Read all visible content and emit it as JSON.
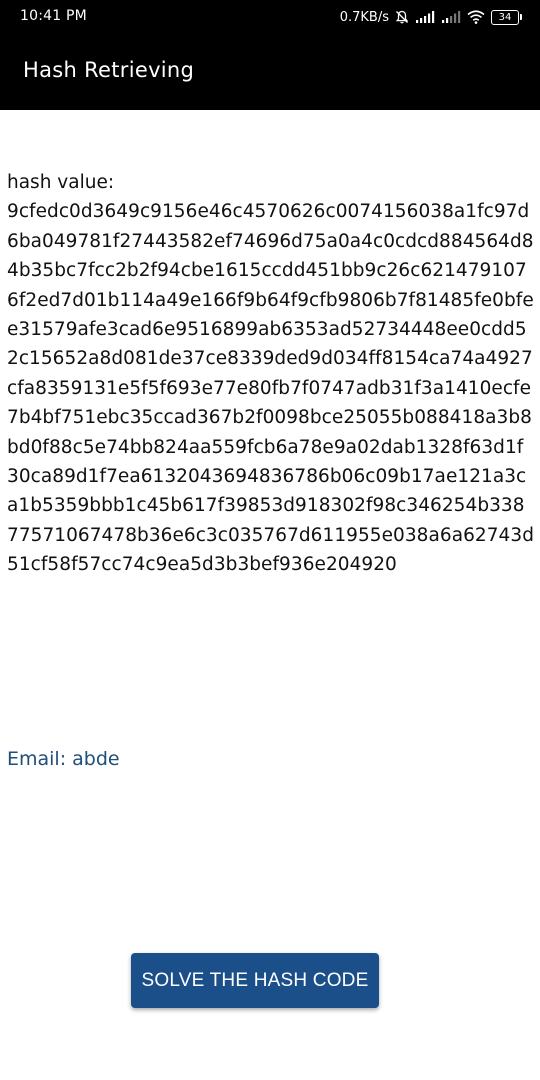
{
  "status_bar": {
    "time": "10:41 PM",
    "network_speed": "0.7KB/s",
    "battery": "34",
    "icons": [
      "alarm-off-icon",
      "signal-icon",
      "signal-weak-icon",
      "wifi-icon",
      "battery-icon"
    ]
  },
  "app_bar": {
    "title": "Hash Retrieving"
  },
  "hash": {
    "label": "hash value:",
    "value": "9cfedc0d3649c9156e46c4570626c0074156038a1fc97d6ba049781f27443582ef74696d75a0a4c0cdcd884564d84b35bc7fcc2b2f94cbe1615ccdd451bb9c26c6214791076f2ed7d01b114a49e166f9b64f9cfb9806b7f81485fe0bfee31579afe3cad6e9516899ab6353ad52734448ee0cdd52c15652a8d081de37ce8339ded9d034ff8154ca74a4927cfa8359131e5f5f693e77e80fb7f0747adb31f3a1410ecfe7b4bf751ebc35ccad367b2f0098bce25055b088418a3b8bd0f88c5e74bb824aa559fcb6a78e9a02dab1328f63d1f30ca89d1f7ea6132043694836786b06c09b17ae121a3ca1b5359bbb1c45b617f39853d918302f98c346254b33877571067478b36e6c3c035767d611955e038a6a62743d51cf58f57cc74c9ea5d3b3bef936e204920"
  },
  "email": {
    "text": "Email: abde"
  },
  "solve_button": {
    "label": "SOLVE THE HASH CODE"
  },
  "colors": {
    "app_bar_bg": "#000000",
    "button_bg": "#1b4f8a",
    "email_text": "#1f4e79"
  }
}
